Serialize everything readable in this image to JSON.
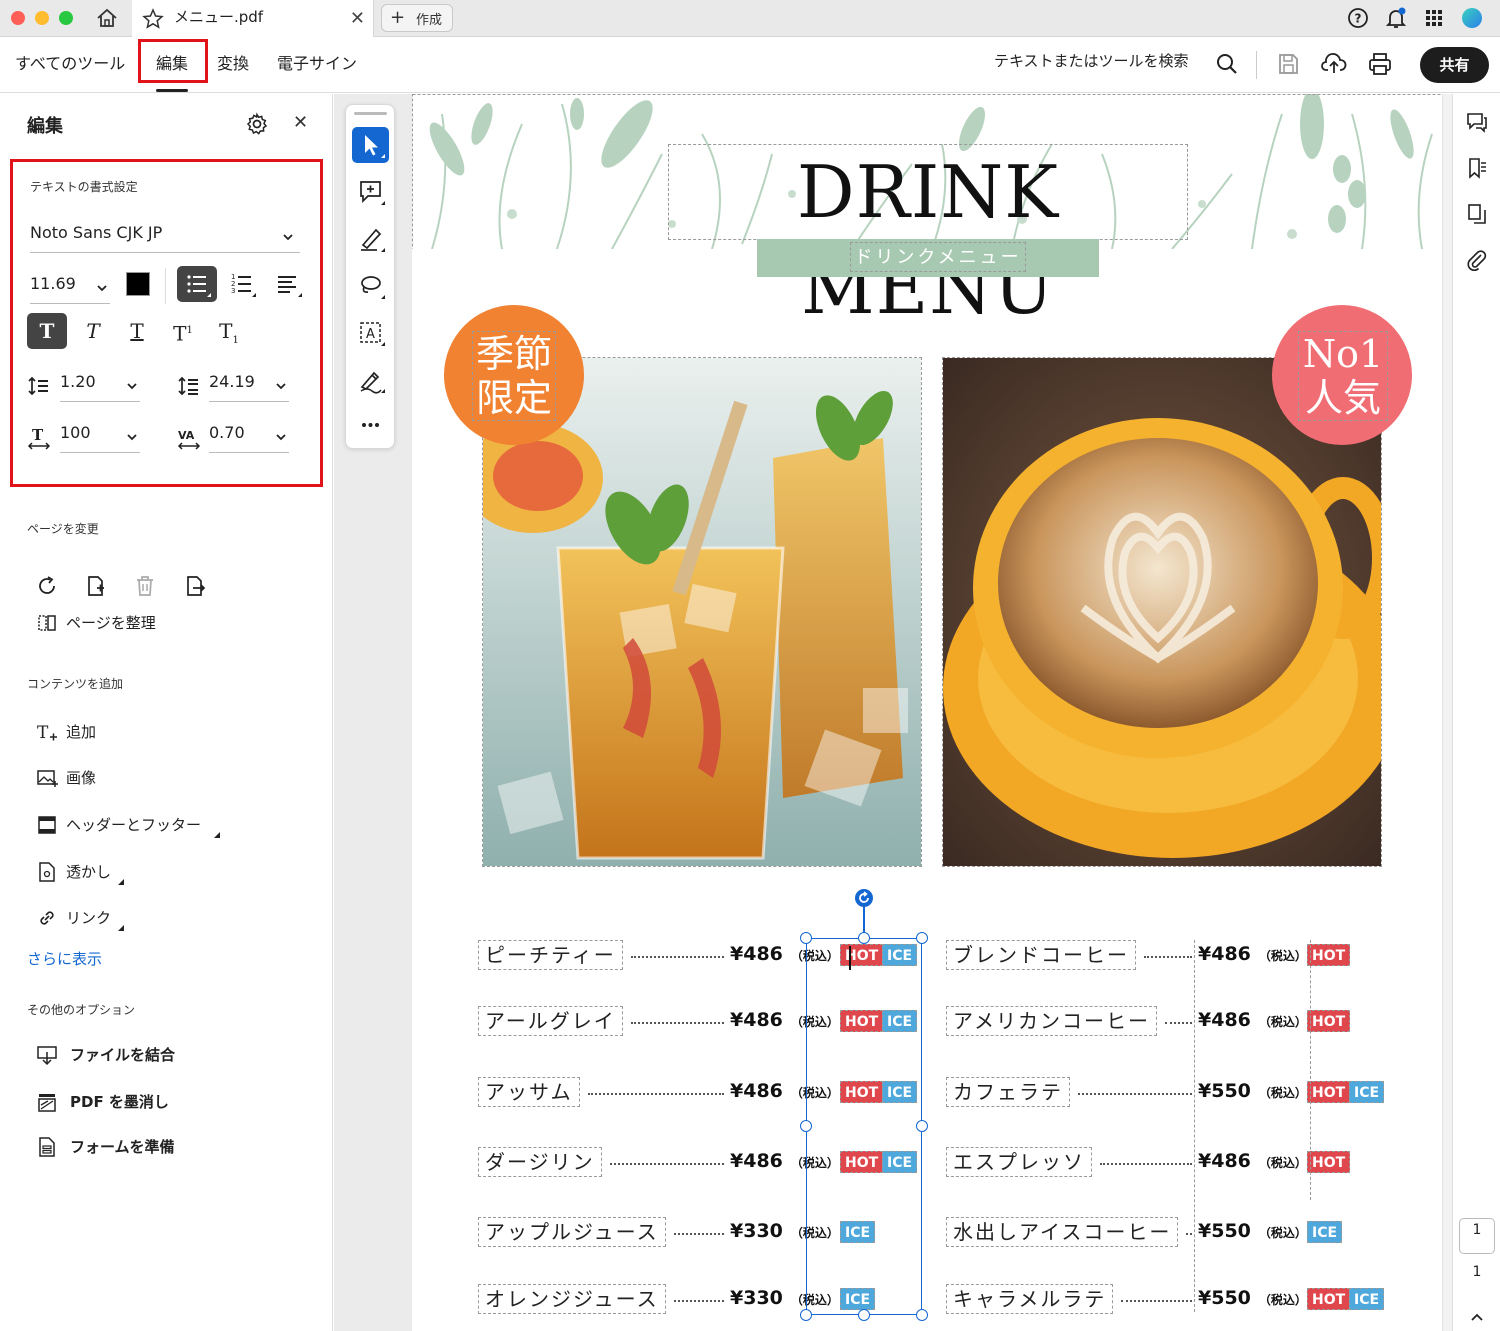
{
  "titlebar": {
    "tab_title": "メニュー.pdf",
    "new_tab_label": "作成"
  },
  "menubar": {
    "items": [
      "すべてのツール",
      "編集",
      "変換",
      "電子サイン"
    ],
    "active_item": "編集",
    "search_placeholder": "テキストまたはツールを検索",
    "share_label": "共有"
  },
  "left_panel": {
    "title": "編集",
    "text_format": {
      "section_title": "テキストの書式設定",
      "font_family": "Noto Sans CJK JP",
      "font_size": "11.69",
      "text_color": "#000000",
      "line_spacing": "1.20",
      "paragraph_spacing": "24.19",
      "horizontal_scale": "100",
      "char_spacing": "0.70"
    },
    "page_section": {
      "title": "ページを変更",
      "organize_label": "ページを整理"
    },
    "content_section": {
      "title": "コンテンツを追加",
      "items": [
        "追加",
        "画像",
        "ヘッダーとフッター",
        "透かし",
        "リンク"
      ],
      "more_label": "さらに表示"
    },
    "other_section": {
      "title": "その他のオプション",
      "items": [
        "ファイルを結合",
        "PDF を墨消し",
        "フォームを準備"
      ]
    }
  },
  "document": {
    "title": "DRINK MENU",
    "subtitle": "ドリンクメニュー",
    "badge_left": "季節限定",
    "badge_right": "No1人気",
    "tax_label": "（税込）",
    "tag_hot": "HOT",
    "tag_ice": "ICE",
    "left_menu": [
      {
        "name": "ピーチティー",
        "price": "¥486",
        "hot": true,
        "ice": true
      },
      {
        "name": "アールグレイ",
        "price": "¥486",
        "hot": true,
        "ice": true
      },
      {
        "name": "アッサム",
        "price": "¥486",
        "hot": true,
        "ice": true
      },
      {
        "name": "ダージリン",
        "price": "¥486",
        "hot": true,
        "ice": true
      },
      {
        "name": "アップルジュース",
        "price": "¥330",
        "hot": false,
        "ice": true
      },
      {
        "name": "オレンジジュース",
        "price": "¥330",
        "hot": false,
        "ice": true
      }
    ],
    "right_menu": [
      {
        "name": "ブレンドコーヒー",
        "price": "¥486",
        "hot": true,
        "ice": false
      },
      {
        "name": "アメリカンコーヒー",
        "price": "¥486",
        "hot": true,
        "ice": false
      },
      {
        "name": "カフェラテ",
        "price": "¥550",
        "hot": true,
        "ice": true
      },
      {
        "name": "エスプレッソ",
        "price": "¥486",
        "hot": true,
        "ice": false
      },
      {
        "name": "水出しアイスコーヒー",
        "price": "¥550",
        "hot": false,
        "ice": true
      },
      {
        "name": "キャラメルラテ",
        "price": "¥550",
        "hot": true,
        "ice": true
      }
    ]
  },
  "page_nav": {
    "current_page": "1",
    "total_pages": "1"
  },
  "colors": {
    "accent_blue": "#1467d1",
    "highlight_red": "#e0131b",
    "hot_tag": "#e0474c",
    "ice_tag": "#4fa8db",
    "sage": "#a8c9b1",
    "badge_orange": "#f08232",
    "badge_pink": "#f06e73"
  },
  "icons": {
    "titlebar": [
      "home-icon",
      "star-icon",
      "close-icon",
      "plus-icon",
      "help-icon",
      "bell-icon",
      "apps-grid-icon",
      "avatar"
    ],
    "menubar": [
      "search-icon",
      "save-icon",
      "cloud-upload-icon",
      "print-icon"
    ],
    "tools": [
      "select-arrow-icon",
      "add-comment-icon",
      "highlight-pen-icon",
      "lasso-icon",
      "text-recognition-icon",
      "sign-pen-icon",
      "more-icon"
    ],
    "right_rail": [
      "comments-icon",
      "bookmarks-icon",
      "pages-icon",
      "attachment-icon"
    ]
  }
}
